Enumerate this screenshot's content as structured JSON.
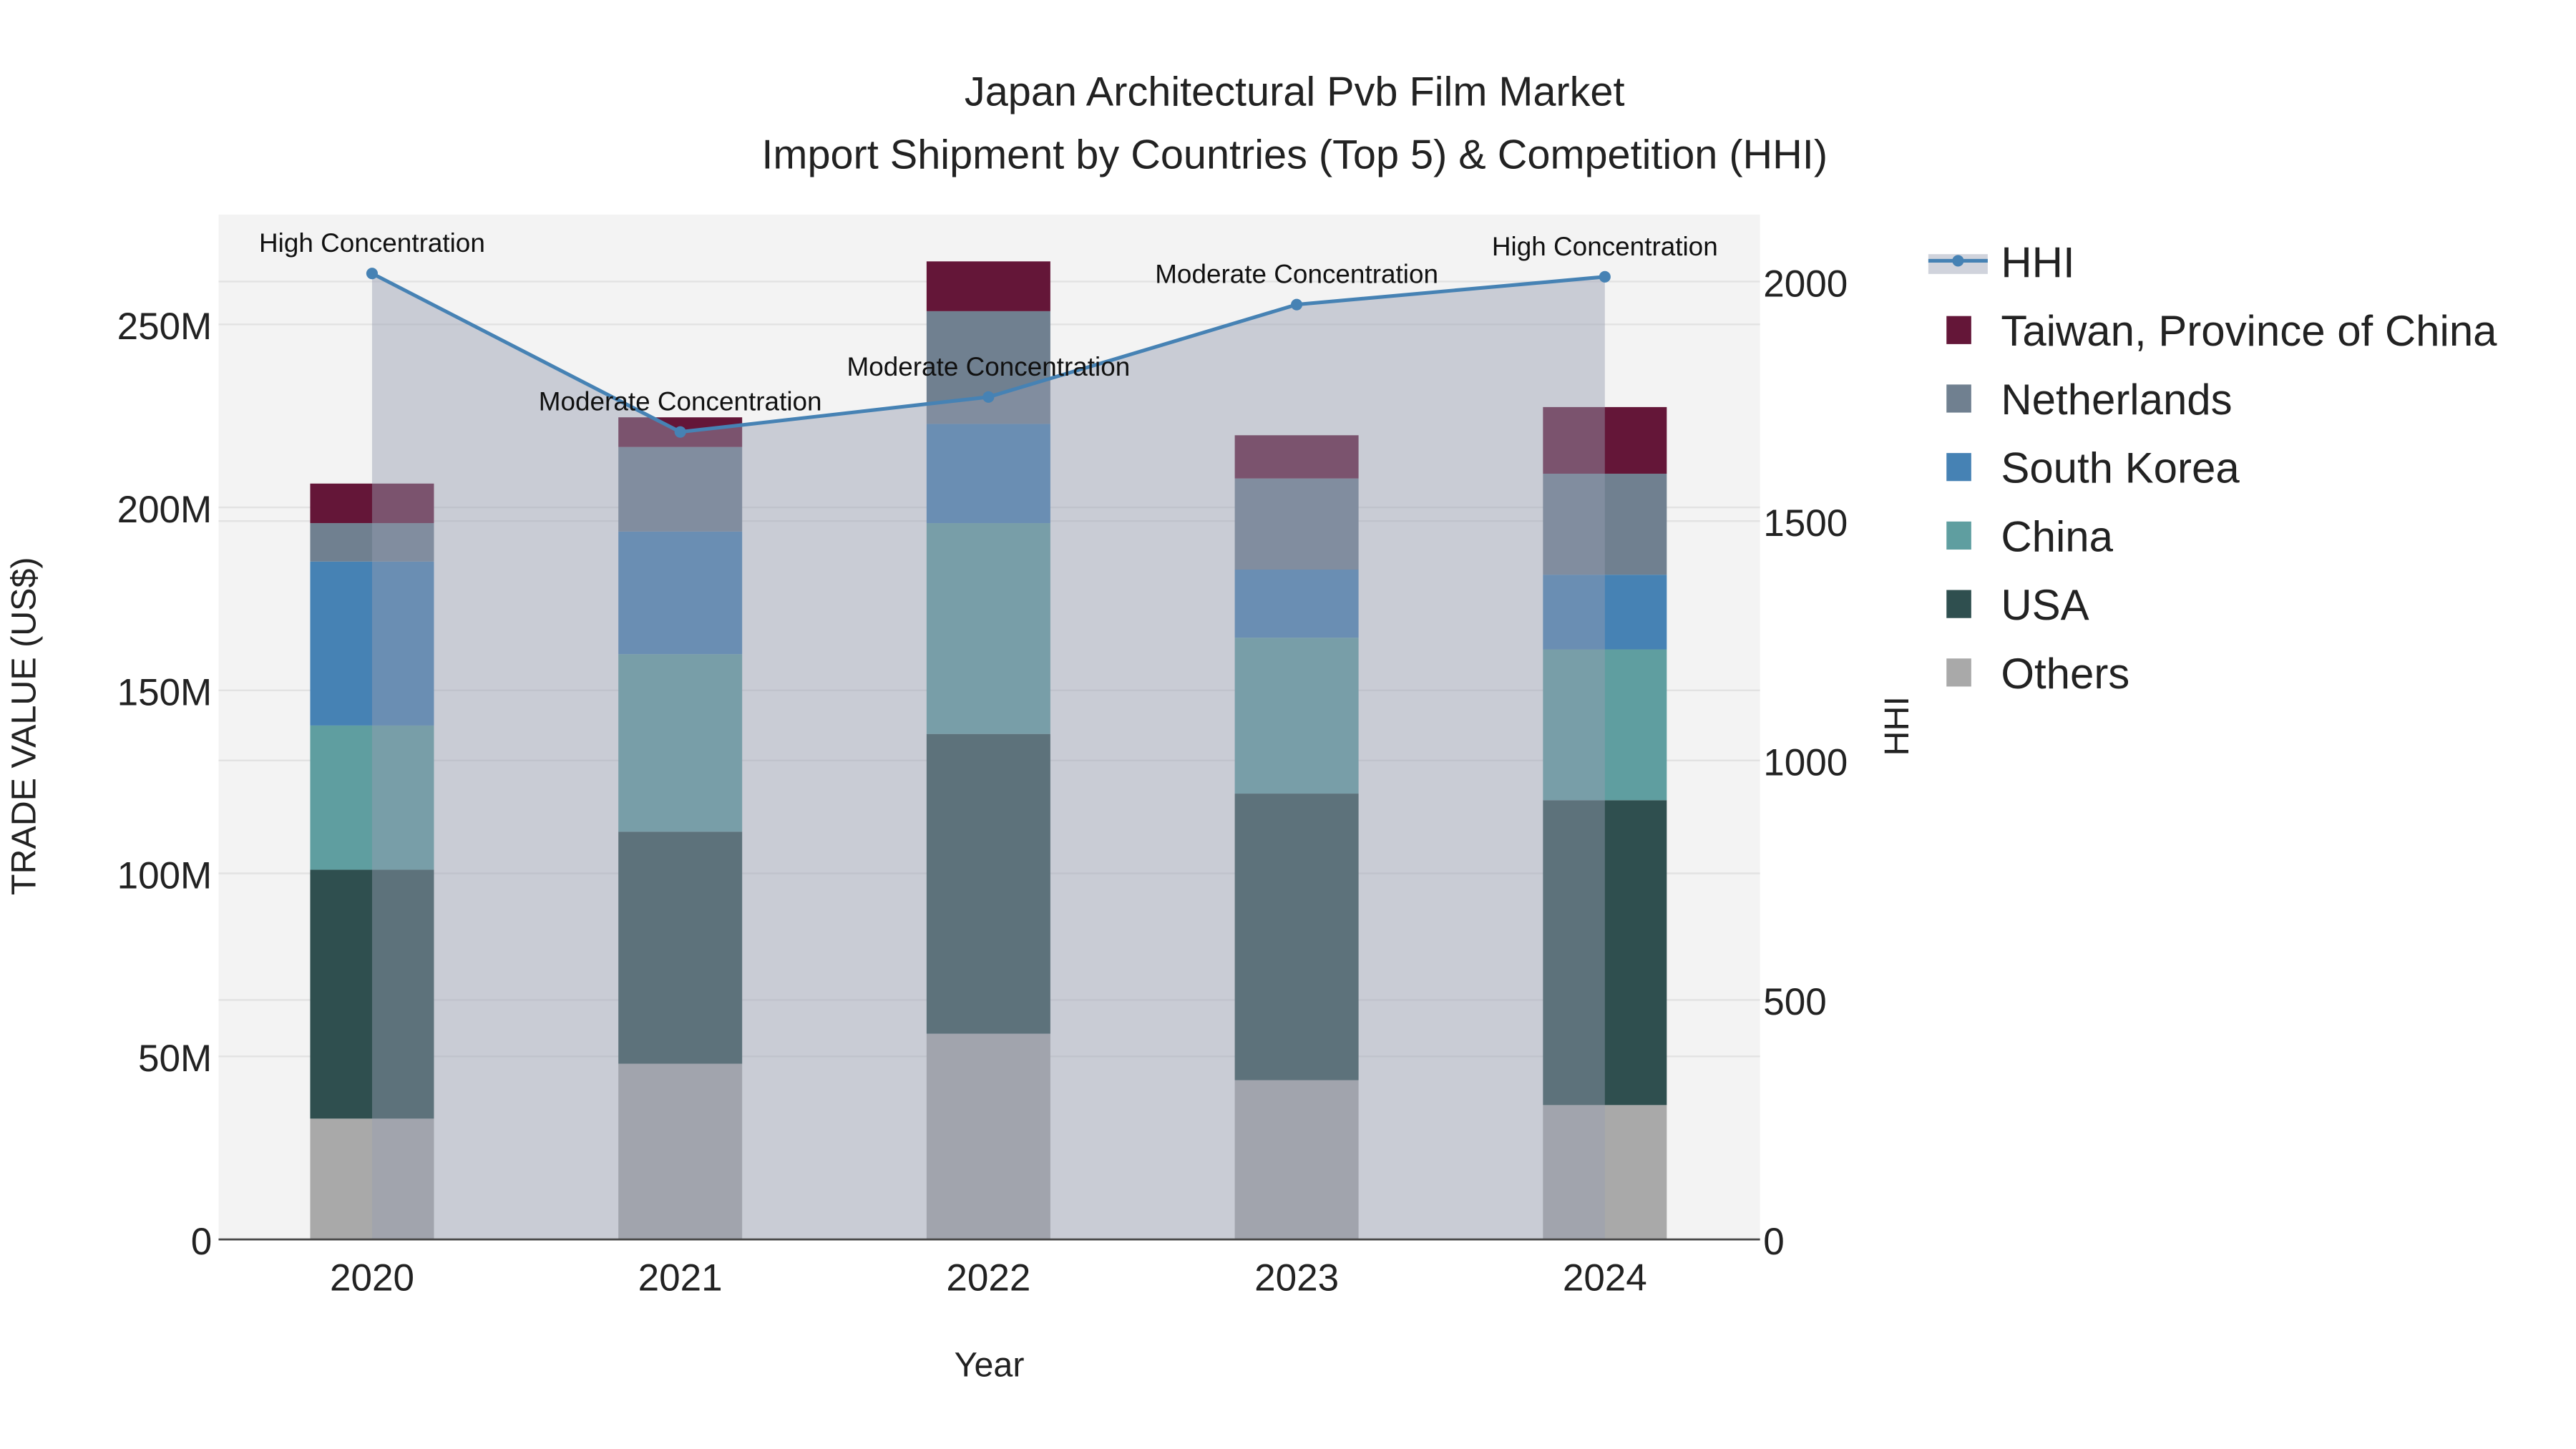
{
  "chart_data": {
    "type": "bar",
    "title": "Japan Architectural Pvb Film Market",
    "subtitle": "Import Shipment by Countries (Top 5) & Competition (HHI)",
    "xlabel": "Year",
    "ylabel": "TRADE VALUE (US$)",
    "y2label": "HHI",
    "categories": [
      "2020",
      "2021",
      "2022",
      "2023",
      "2024"
    ],
    "ylim": [
      0,
      280000000
    ],
    "y2lim": [
      0,
      2140
    ],
    "yticks": [
      {
        "v": 0,
        "label": "0"
      },
      {
        "v": 50000000,
        "label": "50M"
      },
      {
        "v": 100000000,
        "label": "100M"
      },
      {
        "v": 150000000,
        "label": "150M"
      },
      {
        "v": 200000000,
        "label": "200M"
      },
      {
        "v": 250000000,
        "label": "250M"
      }
    ],
    "y2ticks": [
      {
        "v": 0,
        "label": "0"
      },
      {
        "v": 500,
        "label": "500"
      },
      {
        "v": 1000,
        "label": "1000"
      },
      {
        "v": 1500,
        "label": "1500"
      },
      {
        "v": 2000,
        "label": "2000"
      }
    ],
    "stack_order": "bottom-to-top",
    "series": [
      {
        "name": "Others",
        "color": "#a9a9a9",
        "values": [
          33000000,
          48000000,
          56200000,
          43500000,
          36700000
        ]
      },
      {
        "name": "USA",
        "color": "#2f4f4f",
        "values": [
          68000000,
          63400000,
          81900000,
          78300000,
          83300000
        ]
      },
      {
        "name": "China",
        "color": "#5f9ea0",
        "values": [
          39400000,
          48500000,
          57600000,
          42600000,
          41200000
        ]
      },
      {
        "name": "South Korea",
        "color": "#4682b4",
        "values": [
          44800000,
          33500000,
          27100000,
          18600000,
          20400000
        ]
      },
      {
        "name": "Netherlands",
        "color": "#708090",
        "values": [
          10500000,
          23100000,
          30800000,
          24900000,
          27600000
        ]
      },
      {
        "name": "Taiwan, Province of China",
        "color": "#641638",
        "values": [
          10800000,
          8100000,
          13600000,
          11800000,
          18200000
        ]
      }
    ],
    "hhi": {
      "name": "HHI",
      "color": "#4682b4",
      "values": [
        2017,
        1686,
        1759,
        1952,
        2010
      ],
      "annotations": [
        "High Concentration",
        "Moderate Concentration",
        "Moderate Concentration",
        "Moderate Concentration",
        "High Concentration"
      ]
    },
    "legend": [
      "HHI",
      "Taiwan, Province of China",
      "Netherlands",
      "South Korea",
      "China",
      "USA",
      "Others"
    ],
    "legend_placement": "right",
    "grid": true
  }
}
